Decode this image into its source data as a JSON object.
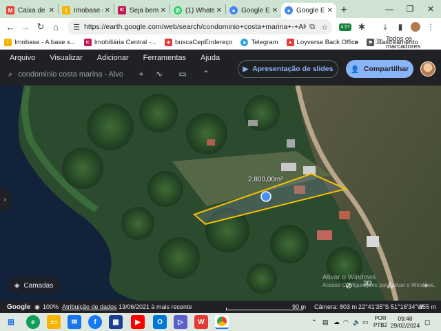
{
  "tabs": [
    {
      "label": "Caixa de e",
      "icon": "gmail-icon",
      "color": "#ea4335",
      "glyph": "M"
    },
    {
      "label": "Imobase o",
      "icon": "imobase-icon",
      "color": "#f4b400",
      "glyph": "i"
    },
    {
      "label": "Seja bem",
      "icon": "imobiliaria-icon",
      "color": "#c2185b",
      "glyph": "IC"
    },
    {
      "label": "(1) Whatsa",
      "icon": "whatsapp-icon",
      "color": "#25d366",
      "glyph": "✆"
    },
    {
      "label": "Google Ea",
      "icon": "google-earth-icon",
      "color": "#4285f4",
      "glyph": "●"
    },
    {
      "label": "Google Ea",
      "icon": "google-earth-icon",
      "color": "#4285f4",
      "glyph": "●",
      "active": true
    }
  ],
  "browser": {
    "url": "https://earth.google.com/web/search/condominio+costa+marina+-+Alvorada+d...",
    "account_badge": "4.57"
  },
  "bookmarks": [
    {
      "label": "Imobase - A base s...",
      "color": "#f4b400",
      "glyph": "i"
    },
    {
      "label": "Imobiliária Central -...",
      "color": "#c2185b",
      "glyph": "IC"
    },
    {
      "label": "buscaCepEndereço",
      "color": "#e53935",
      "glyph": "✈"
    },
    {
      "label": "Telegram",
      "color": "#2aa3e0",
      "glyph": "➤"
    },
    {
      "label": "Loyverse Back Office",
      "color": "#e53935",
      "glyph": "▲"
    },
    {
      "label": "Rastreamento",
      "color": "#555555",
      "glyph": "⚑"
    }
  ],
  "bookmarks_more": "»",
  "bookmarks_all": "Todos os marcadores",
  "earth": {
    "menu": [
      "Arquivo",
      "Visualizar",
      "Adicionar",
      "Ferramentas",
      "Ajuda"
    ],
    "search_text": "condominio costa marina - Alvora",
    "present_label": "Apresentação de slides",
    "share_label": "Compartilhar",
    "layers_label": "Camadas",
    "area_label": "2.800,00m²",
    "watermark_line1": "Ativar o Windows",
    "watermark_line2": "Acesse Configurações para ativar o Windows.",
    "zoom_number": "3D"
  },
  "status": {
    "brand": "Google",
    "percent": "100%",
    "attribution": "Atribuição de dados",
    "date": "13/06/2021 à mais recente",
    "scale": "90 m",
    "camera": "Câmera: 803 m",
    "coords": "22°41'35\"S 51°16'34\"W",
    "elevation": "355 m"
  },
  "taskbar": {
    "lang1": "POR",
    "lang2": "PTB2",
    "time": "09:48",
    "date": "29/02/2024"
  }
}
